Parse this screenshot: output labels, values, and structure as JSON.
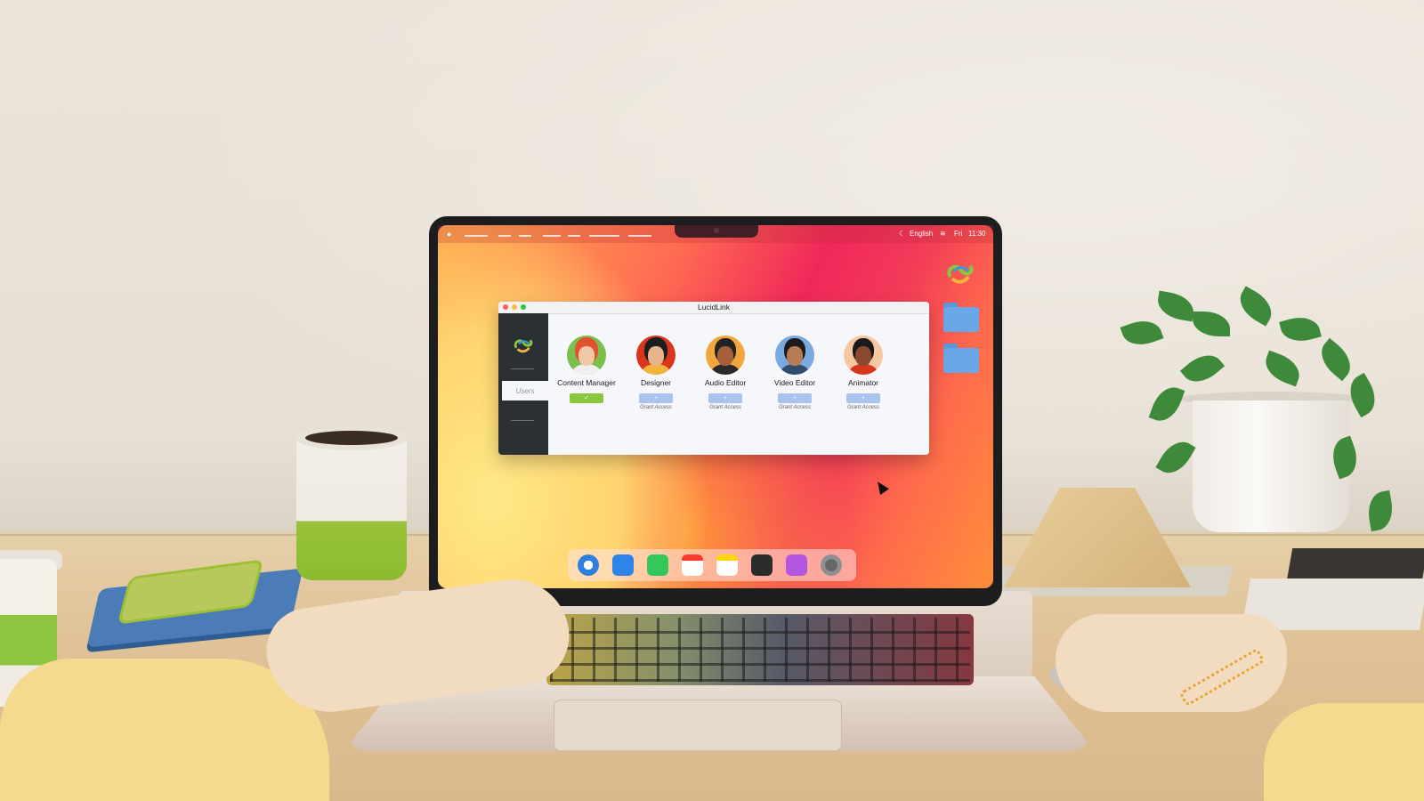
{
  "menubar": {
    "lang": "English",
    "day": "Fri",
    "time": "11:30"
  },
  "app": {
    "title": "LucidLink",
    "sidebar_active": "Users"
  },
  "users": [
    {
      "role": "Content Manager",
      "granted": true,
      "button": "✓",
      "caption": ""
    },
    {
      "role": "Designer",
      "granted": false,
      "button": "+",
      "caption": "Grant Access"
    },
    {
      "role": "Audio Editor",
      "granted": false,
      "button": "+",
      "caption": "Grant Access"
    },
    {
      "role": "Video Editor",
      "granted": false,
      "button": "+",
      "caption": "Grant Access"
    },
    {
      "role": "Animator",
      "granted": false,
      "button": "+",
      "caption": "Grant Access"
    }
  ],
  "colors": {
    "accent_green": "#8cc63f",
    "grant_blue": "#a9c3ea",
    "sidebar_dark": "#2b3034"
  },
  "dock_icons": [
    "safari-icon",
    "mail-icon",
    "facetime-icon",
    "calendar-icon",
    "notes-icon",
    "terminal-icon",
    "podcasts-icon",
    "settings-icon"
  ]
}
